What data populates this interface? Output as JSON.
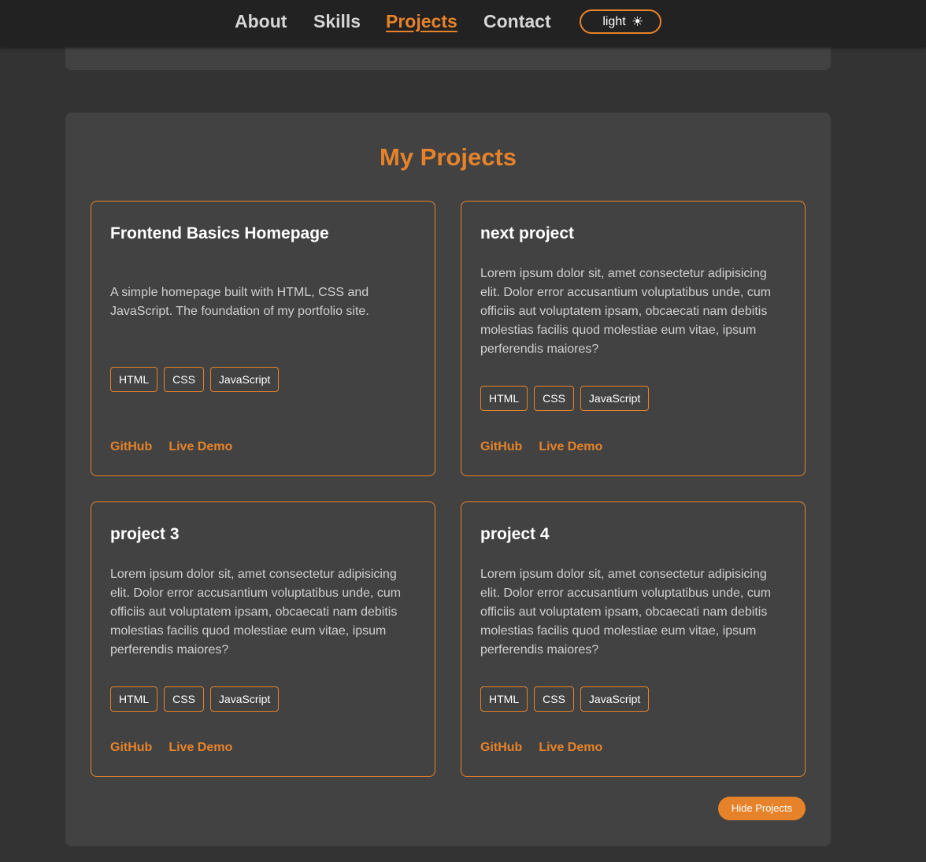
{
  "nav": {
    "links": [
      "About",
      "Skills",
      "Projects",
      "Contact"
    ],
    "active": "Projects",
    "theme_toggle": {
      "label": "light",
      "icon": "sun-icon"
    }
  },
  "projects": {
    "title": "My Projects",
    "cards": [
      {
        "title": "Frontend Basics Homepage",
        "description": "A simple homepage built with HTML, CSS and JavaScript. The foundation of my portfolio site.",
        "tags": [
          "HTML",
          "CSS",
          "JavaScript"
        ],
        "github_label": "GitHub",
        "demo_label": "Live Demo"
      },
      {
        "title": "next project",
        "description": "Lorem ipsum dolor sit, amet consectetur adipisicing elit. Dolor error accusantium voluptatibus unde, cum officiis aut voluptatem ipsam, obcaecati nam debitis molestias facilis quod molestiae eum vitae, ipsum perferendis maiores?",
        "tags": [
          "HTML",
          "CSS",
          "JavaScript"
        ],
        "github_label": "GitHub",
        "demo_label": "Live Demo"
      },
      {
        "title": "project 3",
        "description": "Lorem ipsum dolor sit, amet consectetur adipisicing elit. Dolor error accusantium voluptatibus unde, cum officiis aut voluptatem ipsam, obcaecati nam debitis molestias facilis quod molestiae eum vitae, ipsum perferendis maiores?",
        "tags": [
          "HTML",
          "CSS",
          "JavaScript"
        ],
        "github_label": "GitHub",
        "demo_label": "Live Demo"
      },
      {
        "title": "project 4",
        "description": "Lorem ipsum dolor sit, amet consectetur adipisicing elit. Dolor error accusantium voluptatibus unde, cum officiis aut voluptatem ipsam, obcaecati nam debitis molestias facilis quod molestiae eum vitae, ipsum perferendis maiores?",
        "tags": [
          "HTML",
          "CSS",
          "JavaScript"
        ],
        "github_label": "GitHub",
        "demo_label": "Live Demo"
      }
    ],
    "hide_button": "Hide Projects"
  },
  "colors": {
    "accent": "#e6832a",
    "background": "#333333",
    "surface": "#424242",
    "navbar": "#222222"
  }
}
